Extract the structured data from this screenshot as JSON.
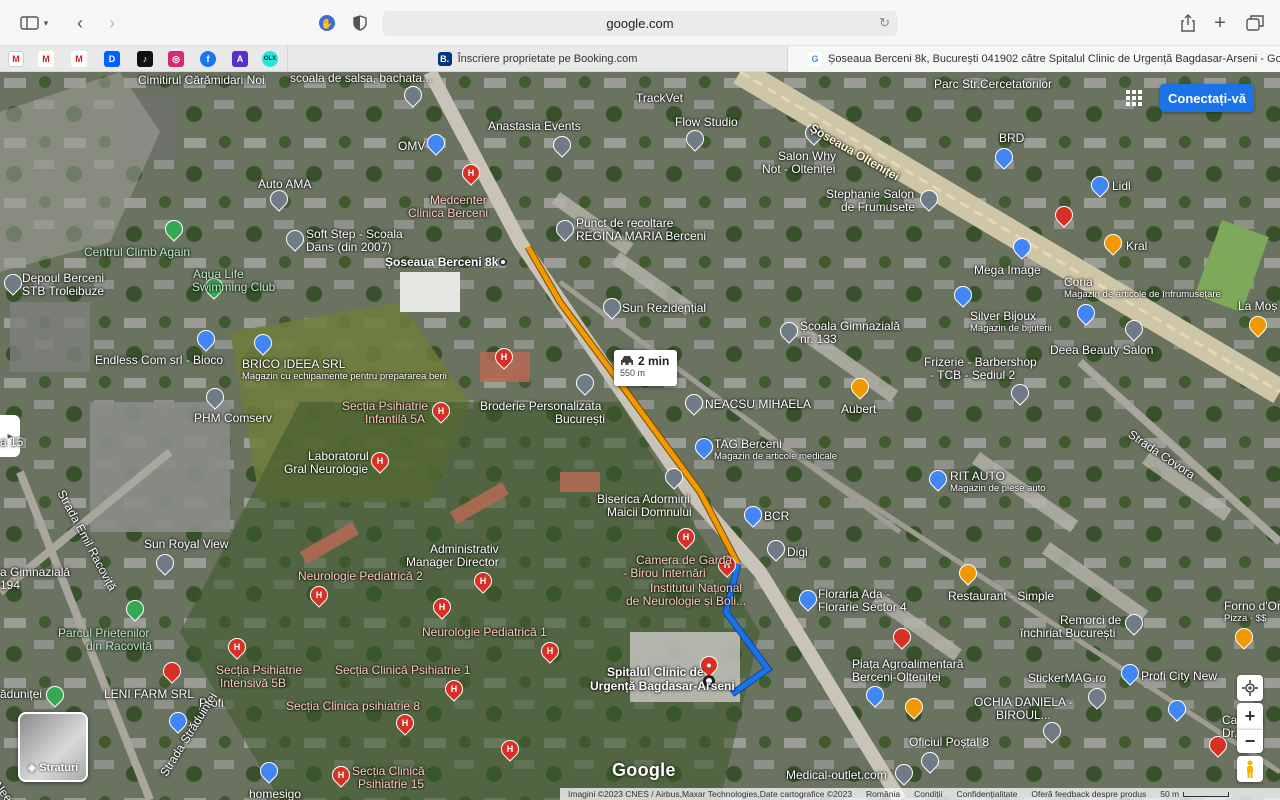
{
  "browser": {
    "url": "google.com",
    "favorites": [
      {
        "icon": "gmail-icon",
        "label": "M"
      },
      {
        "icon": "gmail-icon",
        "label": "M"
      },
      {
        "icon": "gmail-icon",
        "label": "M"
      },
      {
        "icon": "dropbox-icon",
        "label": "D"
      },
      {
        "icon": "tiktok-icon",
        "label": "♪"
      },
      {
        "icon": "instagram-icon",
        "label": "◎"
      },
      {
        "icon": "facebook-icon",
        "label": "f"
      },
      {
        "icon": "figma-icon",
        "label": "A"
      },
      {
        "icon": "olx-icon",
        "label": "OLX"
      }
    ],
    "tabs": [
      {
        "title": "Înscriere proprietate pe Booking.com",
        "icon_label": "B."
      },
      {
        "title": "Șoseaua Berceni 8k, București 041902 către Spitalul Clinic de Urgență Bagdasar-Arseni - Goo...",
        "icon_label": "G"
      }
    ]
  },
  "map": {
    "login_label": "Conectați-vă",
    "route": {
      "duration": "2 min",
      "distance": "550 m"
    },
    "origin_label": "Șoseaua Berceni 8k",
    "destination_label_line1": "Spitalul Clinic de",
    "destination_label_line2": "Urgență Bagdasar-Arseni",
    "layers_label": "Straturi",
    "google_logo": "Google",
    "attribution": {
      "imagery": "Imagini ©2023 CNES / Airbus,Maxar Technologies,Date cartografice ©2023",
      "country": "România",
      "terms": "Condiții",
      "privacy": "Confidențialitate",
      "feedback": "Oferă feedback despre produs",
      "scale": "50 m"
    },
    "labels": {
      "cimitir": "Cimitirul Cărămidari Noi",
      "scoala_salsa": "scoala de salsa, bachata...",
      "trackvet": "TrackVet",
      "parc_str": "Parc Str.Cercetatorilor",
      "sos_olteniței": "Șoseaua Olteniței",
      "anastasia": "Anastasia Events",
      "flow": "Flow Studio",
      "brd": "BRD",
      "omv": "OMV",
      "medcenter1": "Medcenter",
      "medcenter2": "Clinica Berceni",
      "salon_why1": "Salon Why",
      "salon_why2": "Not - Olteniței",
      "auto_ama": "Auto AMA",
      "stephanie1": "Stephanie Salon",
      "stephanie2": "de Frumusete",
      "lidl": "Lidl",
      "soft_step1": "Soft Step - Scoala",
      "soft_step2": "Dans (din 2007)",
      "punct1": "Punct de recoltare",
      "punct2": "REGINA MARIA Berceni",
      "kral": "Kral",
      "centrul_climb": "Centrul Climb Again",
      "mega_image": "Mega Image",
      "coria1": "Coria",
      "coria2": "Magazin de articole de înfrumusețare",
      "depoul1": "Depoul Berceni",
      "depoul2": "STB Troleibuze",
      "aqua1": "Aqua Life",
      "aqua2": "Swimming Club",
      "la_mos": "La Moș",
      "sun_rez": "Sun Rezidențial",
      "silver1": "Silver Bijoux",
      "silver2": "Magazin de bijuterii",
      "scoala_gim1": "Școala Gimnazială",
      "scoala_gim2": "nr. 133",
      "deea": "Deea Beauty Salon",
      "endless": "Endless Com srl - Bioco",
      "brico1": "BRICO IDEEA SRL",
      "brico2": "Magazin cu echipamente pentru prepararea berii",
      "frizerie1": "Frizerie - Barbershop",
      "frizerie2": "- TCB - Sediul 2",
      "aubert": "Aubert",
      "neacsu": "NEACSU MIHAELA",
      "sectia_inf1": "Secția Psihiatrie",
      "sectia_inf2": "Infantilă 5A",
      "broderie1": "Broderie Personalizata",
      "broderie2": "București",
      "phm": "PHM Comserv",
      "tag1": "TAG Berceni",
      "tag2": "Magazin de articole medicale",
      "strada_covora": "Strada Covora",
      "a15": "a 15",
      "lab1": "Laboratorul",
      "lab2": "Gral Neurologie",
      "rit1": "RIT AUTO",
      "rit2": "Magazin de piese auto",
      "biserica1": "Biserica Adormirii",
      "biserica2": "Maicii Domnului",
      "bcr": "BCR",
      "strada_emil": "Strada Emil Racoviță",
      "sun_royal": "Sun Royal View",
      "administrativ1": "Administrativ",
      "administrativ2": "Manager Director",
      "digi": "Digi",
      "scoala_194a": "a Gimnazială",
      "scoala_194b": "194",
      "neuro_ped2": "Neurologie Pediatrică 2",
      "camera1": "Camera de Gardă",
      "camera2": "- Birou Internări",
      "institut1": "Institutul Național",
      "institut2": "de Neurologie și Boli...",
      "restaurant": "Restaurant - Simple",
      "floraria1": "Floraria Ada -",
      "floraria2": "Florarie Sector 4",
      "forno1": "Forno d'Or",
      "forno2": "Pizza · $$",
      "parcul1": "Parcul Prietenilor",
      "parcul2": "din Racoviță",
      "neuro_ped1": "Neurologie Pediatrică 1",
      "remorci1": "Remorci de",
      "remorci2": "închiriat București",
      "piata1": "Piața Agroalimentară",
      "piata2": "Berceni-Olteniței",
      "sectia_int1": "Secția Psihiatrie",
      "sectia_int2": "Intensivă 5B",
      "sectia6": "Secția Clinică Psihiatrie 1",
      "profi_city": "Profi City New",
      "leni": "LENI FARM SRL",
      "adunitei": "ăduniței",
      "stickermag": "StickerMAG.ro",
      "cabinet1": "Cabinet",
      "cabinet2": "Dr. Tan",
      "profi": "Profi",
      "sectia8": "Secția Clinica psihiatrie 8",
      "ochia1": "OCHIA DANIELA -",
      "ochia2": "BIROUL...",
      "oficiul": "Oficiul Poștal 8",
      "strada_stradunitei": "Strada Străduinței",
      "sectia15a": "Secția Clinică",
      "sectia15b": "Psihiatrie 15",
      "homesigo": "homesigo",
      "medical_outlet": "Medical-outlet.com",
      "alee": "Aleea T..."
    }
  },
  "colors": {
    "route_walk": "#f29900",
    "route_drive": "#1a73e8",
    "login_button": "#1a73e8",
    "hospital_pin": "#d93025",
    "shop_pin": "#4285f4",
    "food_pin": "#f29900",
    "generic_pin": "#6f7b86",
    "park_pin": "#34a853"
  }
}
